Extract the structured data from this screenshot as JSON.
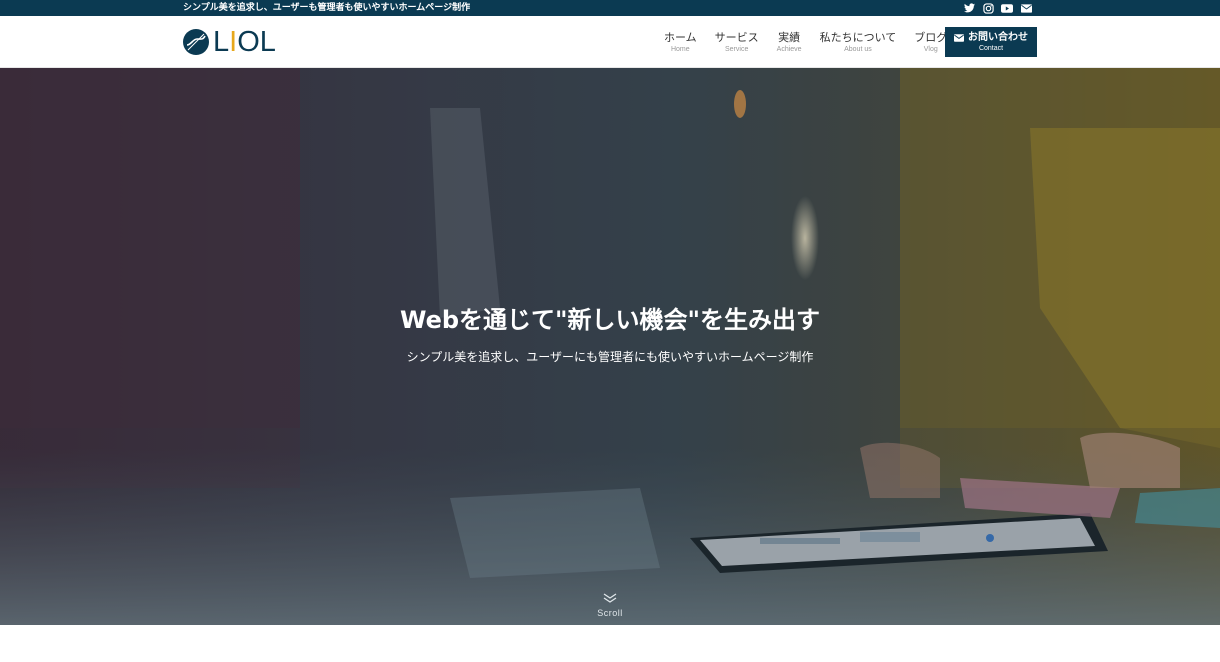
{
  "topbar": {
    "tagline": "シンプル美を追求し、ユーザーも管理者も使いやすいホームページ制作",
    "social_icons": [
      "twitter-icon",
      "instagram-icon",
      "youtube-icon",
      "mail-icon"
    ]
  },
  "brand": {
    "logo_text_l": "L",
    "logo_text_i": "I",
    "logo_text_ol": "OL",
    "colors": {
      "navy": "#0b3a52",
      "accent": "#e7a81c"
    }
  },
  "nav": {
    "items": [
      {
        "label": "ホーム",
        "sub": "Home"
      },
      {
        "label": "サービス",
        "sub": "Service"
      },
      {
        "label": "実績",
        "sub": "Achieve"
      },
      {
        "label": "私たちについて",
        "sub": "About us"
      },
      {
        "label": "ブログ",
        "sub": "Vlog"
      }
    ],
    "contact": {
      "label": "お問い合わせ",
      "sub": "Contact"
    }
  },
  "hero": {
    "title": "Webを通じて\"新しい機会\"を生み出す",
    "subtitle": "シンプル美を追求し、ユーザーにも管理者にも使いやすいホームページ制作",
    "scroll_label": "Scroll"
  }
}
